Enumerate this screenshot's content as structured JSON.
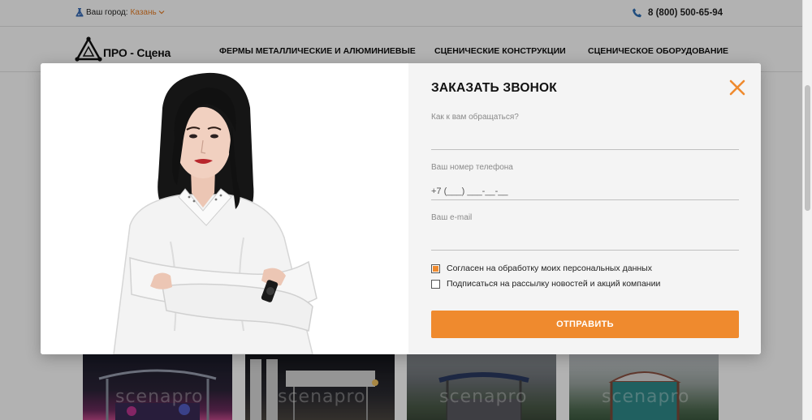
{
  "header": {
    "city_label": "Ваш город:",
    "city_value": "Казань",
    "phone": "8 (800) 500-65-94"
  },
  "logo": {
    "text": "ПРО - Сцена"
  },
  "nav": {
    "items": [
      {
        "label": "ФЕРМЫ МЕТАЛЛИЧЕСКИЕ И АЛЮМИНИЕВЫЕ"
      },
      {
        "label": "СЦЕНИЧЕСКИЕ КОНСТРУКЦИИ"
      },
      {
        "label": "СЦЕНИЧЕСКОЕ ОБОРУДОВАНИЕ"
      }
    ]
  },
  "cards": {
    "watermark": "scenapro"
  },
  "modal": {
    "title": "ЗАКАЗАТЬ ЗВОНОК",
    "name_label": "Как к вам обращаться?",
    "phone_label": "Ваш номер телефона",
    "phone_placeholder": "+7 (___) ___-__-__",
    "email_label": "Ваш e-mail",
    "consent_label": "Согласен на обработку моих персональных данных",
    "consent_checked": true,
    "newsletter_label": "Подписаться на рассылку новостей и акций компании",
    "newsletter_checked": false,
    "submit_label": "ОТПРАВИТЬ"
  },
  "colors": {
    "accent": "#ef8a2e",
    "phone_icon": "#2f6fb5",
    "form_bg": "#f4f4f4"
  },
  "icons": {
    "city": "flask-icon",
    "phone": "phone-icon",
    "close": "close-icon",
    "logo": "triangle-truss-logo"
  }
}
